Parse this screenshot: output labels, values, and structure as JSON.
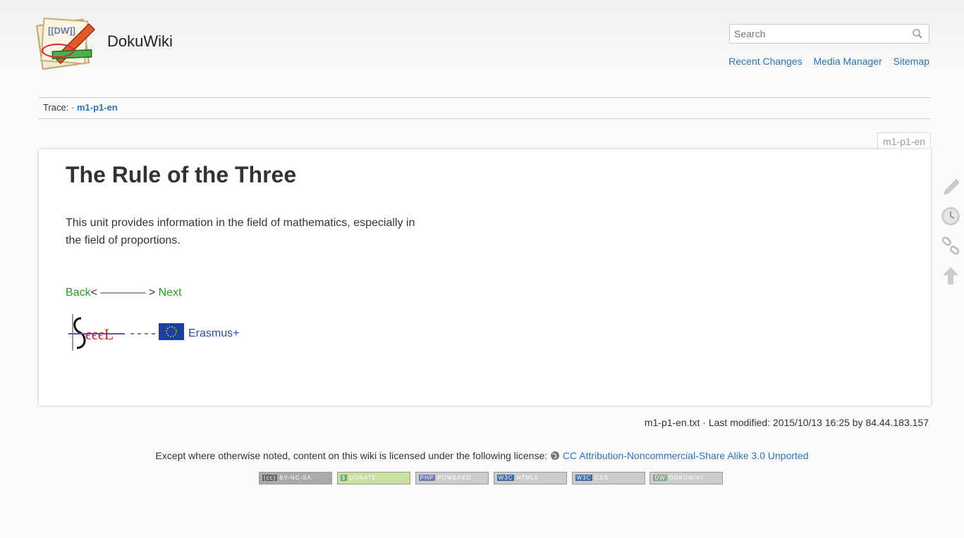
{
  "header": {
    "site_title": "DokuWiki",
    "search_placeholder": "Search",
    "links": [
      "Recent Changes",
      "Media Manager",
      "Sitemap"
    ]
  },
  "breadcrumb": {
    "label": "Trace:",
    "sep": "·",
    "current": "m1-p1-en"
  },
  "page": {
    "id_tab": "m1-p1-en",
    "heading": "The Rule of the Three",
    "paragraph": "This unit provides information in the field of mathematics, especially in the field of proportions.",
    "nav_back": "Back",
    "nav_middle": "< ———— > ",
    "nav_next": "Next",
    "erasmus_label": "Erasmus+"
  },
  "footer": {
    "docinfo": "m1-p1-en.txt · Last modified: 2015/10/13 16:25 by 84.44.183.157",
    "license_text": "Except where otherwise noted, content on this wiki is licensed under the following license:",
    "license_link": "CC Attribution-Noncommercial-Share Alike 3.0 Unported",
    "badges": [
      {
        "tag": "(cc)",
        "text": "BY-NC-SA"
      },
      {
        "tag": "$",
        "text": "DONATE"
      },
      {
        "tag": "PHP",
        "text": "POWERED"
      },
      {
        "tag": "W3C",
        "text": "HTML5"
      },
      {
        "tag": "W3C",
        "text": "CSS"
      },
      {
        "tag": "DW",
        "text": "DOKUWIKI"
      }
    ]
  },
  "icons": [
    "dokuwiki-logo-icon",
    "search-icon",
    "edit-pencil-icon",
    "history-clock-icon",
    "backlinks-chain-icon",
    "back-to-top-arrow-icon",
    "globe-icon"
  ],
  "colors": {
    "link": "#2b73b7",
    "nav_green": "#2a9a2a"
  }
}
